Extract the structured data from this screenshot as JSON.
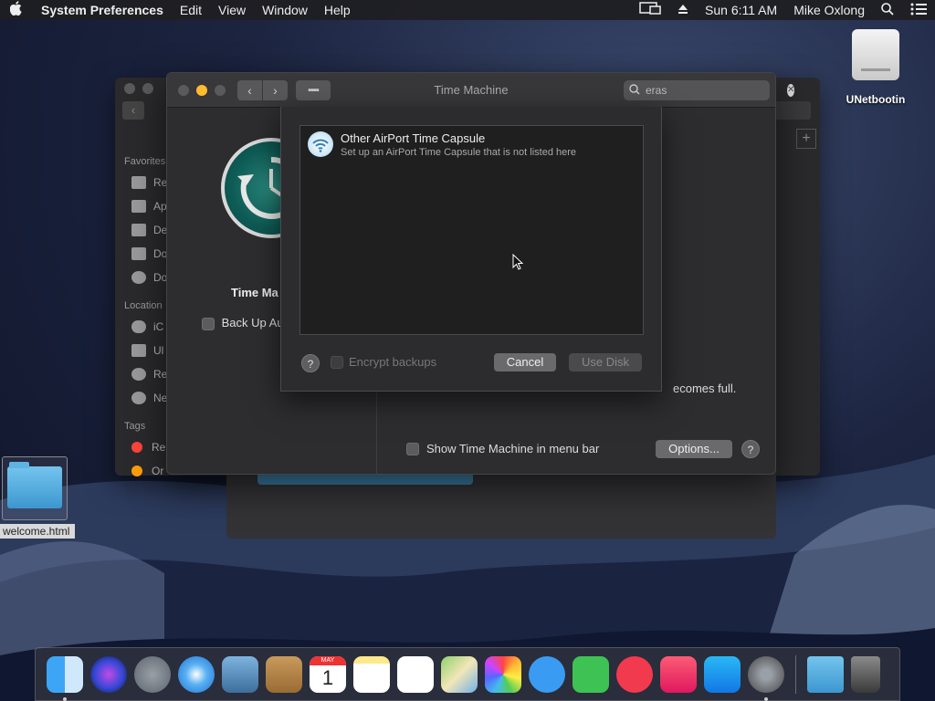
{
  "menubar": {
    "app_name": "System Preferences",
    "menus": [
      "Edit",
      "View",
      "Window",
      "Help"
    ],
    "clock": "Sun 6:11 AM",
    "user": "Mike Oxlong"
  },
  "desktop": {
    "drive_label": "UNetbootin",
    "file_label": "welcome.html"
  },
  "finder": {
    "favorites_header": "Favorites",
    "favorites": [
      "Re",
      "Ap",
      "De",
      "Do",
      "Do"
    ],
    "locations_header": "Location",
    "locations": [
      "iC",
      "Ul",
      "Re",
      "Ne"
    ],
    "tags_header": "Tags",
    "tags": [
      {
        "label": "Re",
        "color": "#ff453a"
      },
      {
        "label": "Or",
        "color": "#ff9f0a"
      }
    ]
  },
  "prefs": {
    "window_title": "Time Machine",
    "search_value": "eras",
    "pane_name": "Time Ma",
    "backup_auto_label": "Back Up Au",
    "full_text": "ecomes full.",
    "show_menubar_label": "Show Time Machine in menu bar",
    "options_label": "Options...",
    "help_label": "?"
  },
  "sheet": {
    "disks": [
      {
        "title": "Other AirPort Time Capsule",
        "subtitle": "Set up an AirPort Time Capsule that is not listed here"
      }
    ],
    "help_label": "?",
    "encrypt_label": "Encrypt backups",
    "cancel_label": "Cancel",
    "use_disk_label": "Use Disk"
  },
  "dock": {
    "calendar_month": "MAY",
    "calendar_day": "1"
  },
  "colors": {
    "close": "#ff5f57",
    "minimize": "#febc2e",
    "zoom": "#5a5a5d",
    "accent": "#3c97cf"
  }
}
